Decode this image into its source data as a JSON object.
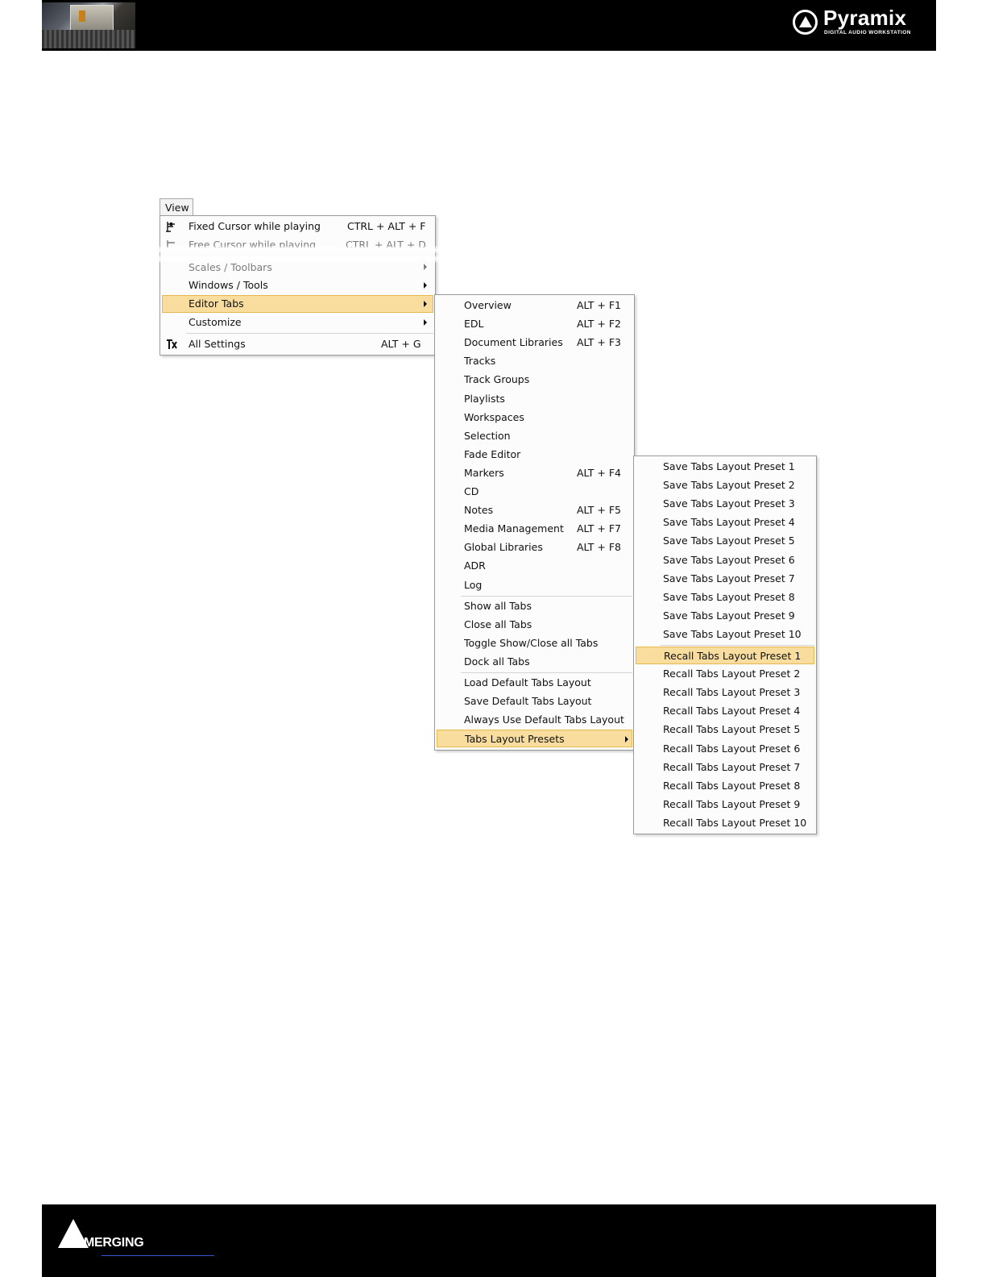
{
  "header": {
    "brand": "Pyramix",
    "tagline": "DIGITAL AUDIO WORKSTATION"
  },
  "footer": {
    "brand": "MERGING"
  },
  "menubar": {
    "view_label": "View"
  },
  "view_menu": {
    "items": [
      {
        "label": "Fixed Cursor while playing",
        "shortcut": "CTRL + ALT + F",
        "icon": "fixed-cursor-icon"
      },
      {
        "label": "Free Cursor while playing",
        "shortcut": "CTRL + ALT + D",
        "icon": "free-cursor-icon"
      },
      {
        "label": "Scales / Toolbars"
      },
      {
        "label": "Windows / Tools"
      },
      {
        "label": "Editor Tabs"
      },
      {
        "label": "Customize"
      },
      {
        "label": "All Settings",
        "shortcut": "ALT + G",
        "icon": "settings-tools-icon"
      }
    ]
  },
  "editor_tabs_menu": {
    "items": [
      {
        "label": "Overview",
        "shortcut": "ALT + F1"
      },
      {
        "label": "EDL",
        "shortcut": "ALT + F2"
      },
      {
        "label": "Document Libraries",
        "shortcut": "ALT + F3"
      },
      {
        "label": "Tracks"
      },
      {
        "label": "Track Groups"
      },
      {
        "label": "Playlists"
      },
      {
        "label": "Workspaces"
      },
      {
        "label": "Selection"
      },
      {
        "label": "Fade Editor"
      },
      {
        "label": "Markers",
        "shortcut": "ALT + F4"
      },
      {
        "label": "CD"
      },
      {
        "label": "Notes",
        "shortcut": "ALT + F5"
      },
      {
        "label": "Media Management",
        "shortcut": "ALT + F7"
      },
      {
        "label": "Global Libraries",
        "shortcut": "ALT + F8"
      },
      {
        "label": "ADR"
      },
      {
        "label": "Log"
      },
      {
        "label": "Show all Tabs"
      },
      {
        "label": "Close all Tabs"
      },
      {
        "label": "Toggle Show/Close all Tabs"
      },
      {
        "label": "Dock all Tabs"
      },
      {
        "label": "Load Default Tabs Layout"
      },
      {
        "label": "Save Default Tabs Layout"
      },
      {
        "label": "Always Use Default Tabs Layout"
      },
      {
        "label": "Tabs Layout Presets"
      }
    ]
  },
  "presets_menu": {
    "save": [
      "Save Tabs Layout Preset 1",
      "Save Tabs Layout Preset 2",
      "Save Tabs Layout Preset 3",
      "Save Tabs Layout Preset 4",
      "Save Tabs Layout Preset 5",
      "Save Tabs Layout Preset 6",
      "Save Tabs Layout Preset 7",
      "Save Tabs Layout Preset 8",
      "Save Tabs Layout Preset 9",
      "Save Tabs Layout Preset 10"
    ],
    "recall": [
      "Recall Tabs Layout Preset 1",
      "Recall Tabs Layout Preset 2",
      "Recall Tabs Layout Preset 3",
      "Recall Tabs Layout Preset 4",
      "Recall Tabs Layout Preset 5",
      "Recall Tabs Layout Preset 6",
      "Recall Tabs Layout Preset 7",
      "Recall Tabs Layout Preset 8",
      "Recall Tabs Layout Preset 9",
      "Recall Tabs Layout Preset 10"
    ]
  },
  "colors": {
    "highlight_fill": "#f8dd9f",
    "highlight_border": "#e6b94d",
    "menu_border": "#9a9a9a"
  }
}
